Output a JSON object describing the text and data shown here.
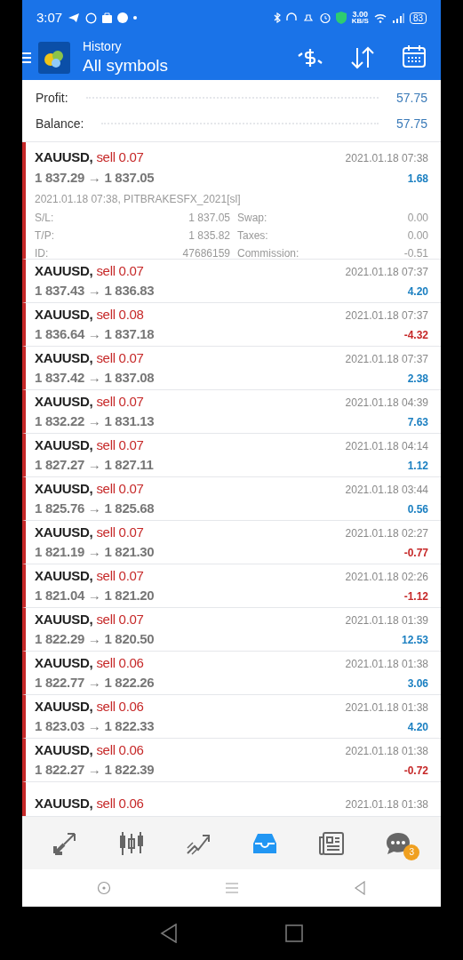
{
  "status_bar": {
    "time": "3:07",
    "speed": "3.00",
    "speed_unit": "KB/S",
    "battery": "83"
  },
  "header": {
    "title": "History",
    "subtitle": "All symbols"
  },
  "summary": [
    {
      "label": "Profit:",
      "value": "57.75"
    },
    {
      "label": "Balance:",
      "value": "57.75"
    }
  ],
  "expanded_deal": {
    "symbol": "XAUUSD,",
    "kind": "sell",
    "side": "sell 0.07",
    "prices": "1 837.29 → 1 837.05",
    "time": "2021.01.18 07:38",
    "profit": "1.68",
    "loss": false,
    "comment": "2021.01.18 07:38, PITBRAKESFX_2021[sl]",
    "details": [
      {
        "label": "S/L:",
        "value": "1 837.05",
        "label2": "Swap:",
        "value2": "0.00"
      },
      {
        "label": "T/P:",
        "value": "1 835.82",
        "label2": "Taxes:",
        "value2": "0.00"
      },
      {
        "label": "ID:",
        "value": "47686159",
        "label2": "Commission:",
        "value2": "-0.51"
      }
    ]
  },
  "deals": [
    {
      "symbol": "XAUUSD,",
      "kind": "sell",
      "side": "sell 0.07",
      "prices": "1 837.43 → 1 836.83",
      "time": "2021.01.18 07:37",
      "profit": "4.20",
      "loss": false
    },
    {
      "symbol": "XAUUSD,",
      "kind": "sell",
      "side": "sell 0.08",
      "prices": "1 836.64 → 1 837.18",
      "time": "2021.01.18 07:37",
      "profit": "-4.32",
      "loss": true
    },
    {
      "symbol": "XAUUSD,",
      "kind": "sell",
      "side": "sell 0.07",
      "prices": "1 837.42 → 1 837.08",
      "time": "2021.01.18 07:37",
      "profit": "2.38",
      "loss": false
    },
    {
      "symbol": "XAUUSD,",
      "kind": "sell",
      "side": "sell 0.07",
      "prices": "1 832.22 → 1 831.13",
      "time": "2021.01.18 04:39",
      "profit": "7.63",
      "loss": false
    },
    {
      "symbol": "XAUUSD,",
      "kind": "sell",
      "side": "sell 0.07",
      "prices": "1 827.27 → 1 827.11",
      "time": "2021.01.18 04:14",
      "profit": "1.12",
      "loss": false
    },
    {
      "symbol": "XAUUSD,",
      "kind": "sell",
      "side": "sell 0.07",
      "prices": "1 825.76 → 1 825.68",
      "time": "2021.01.18 03:44",
      "profit": "0.56",
      "loss": false
    },
    {
      "symbol": "XAUUSD,",
      "kind": "sell",
      "side": "sell 0.07",
      "prices": "1 821.19 → 1 821.30",
      "time": "2021.01.18 02:27",
      "profit": "-0.77",
      "loss": true
    },
    {
      "symbol": "XAUUSD,",
      "kind": "sell",
      "side": "sell 0.07",
      "prices": "1 821.04 → 1 821.20",
      "time": "2021.01.18 02:26",
      "profit": "-1.12",
      "loss": true
    },
    {
      "symbol": "XAUUSD,",
      "kind": "sell",
      "side": "sell 0.07",
      "prices": "1 822.29 → 1 820.50",
      "time": "2021.01.18 01:39",
      "profit": "12.53",
      "loss": false
    },
    {
      "symbol": "XAUUSD,",
      "kind": "sell",
      "side": "sell 0.06",
      "prices": "1 822.77 → 1 822.26",
      "time": "2021.01.18 01:38",
      "profit": "3.06",
      "loss": false
    },
    {
      "symbol": "XAUUSD,",
      "kind": "sell",
      "side": "sell 0.06",
      "prices": "1 823.03 → 1 822.33",
      "time": "2021.01.18 01:38",
      "profit": "4.20",
      "loss": false
    },
    {
      "symbol": "XAUUSD,",
      "kind": "sell",
      "side": "sell 0.06",
      "prices": "1 822.27 → 1 822.39",
      "time": "2021.01.18 01:38",
      "profit": "-0.72",
      "loss": true
    },
    {
      "symbol": "XAUUSD,",
      "kind": "sell",
      "side": "sell 0.06",
      "time": "2021.01.18 01:38"
    }
  ],
  "bottom_nav": [
    {
      "kind": "trade",
      "selected": false
    },
    {
      "kind": "chart",
      "selected": false
    },
    {
      "kind": "trend",
      "selected": false
    },
    {
      "kind": "history",
      "selected": true
    },
    {
      "kind": "news",
      "selected": false
    },
    {
      "kind": "chat",
      "selected": false,
      "badge": "3"
    }
  ]
}
